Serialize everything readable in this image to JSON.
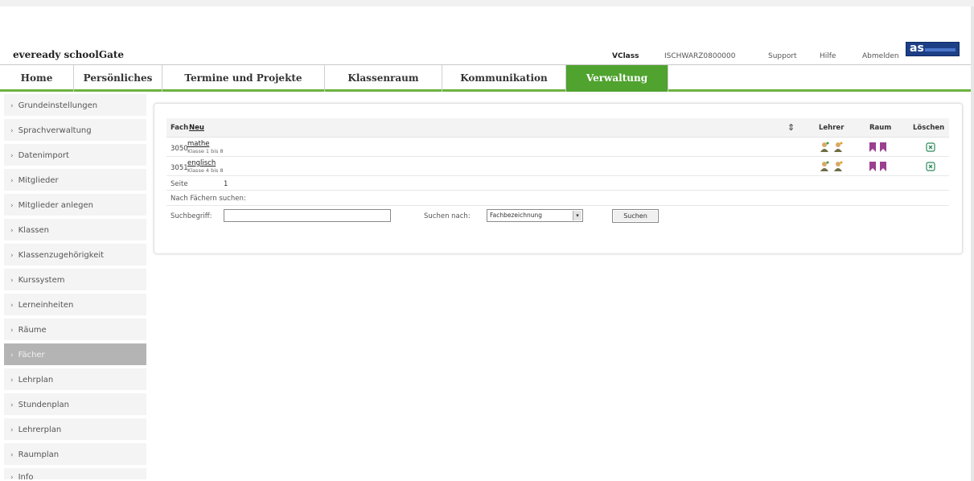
{
  "app": {
    "title": "eveready schoolGate",
    "logo_text": "as"
  },
  "header_meta": {
    "vclass": "VClass",
    "user_id": "ISCHWARZ0800000",
    "support": "Support",
    "help": "Hilfe",
    "logout": "Abmelden"
  },
  "tabs": [
    {
      "label": "Home"
    },
    {
      "label": "Persönliches"
    },
    {
      "label": "Termine und Projekte"
    },
    {
      "label": "Klassenraum"
    },
    {
      "label": "Kommunikation"
    },
    {
      "label": "Verwaltung",
      "active": true
    }
  ],
  "sidebar": {
    "items": [
      {
        "label": "Grundeinstellungen"
      },
      {
        "label": "Sprachverwaltung"
      },
      {
        "label": "Datenimport"
      },
      {
        "label": "Mitglieder"
      },
      {
        "label": "Mitglieder anlegen"
      },
      {
        "label": "Klassen"
      },
      {
        "label": "Klassenzugehörigkeit"
      },
      {
        "label": "Kurssystem"
      },
      {
        "label": "Lerneinheiten"
      },
      {
        "label": "Räume"
      },
      {
        "label": "Fächer",
        "active": true
      },
      {
        "label": "Lehrplan"
      },
      {
        "label": "Stundenplan"
      },
      {
        "label": "Lehrerplan"
      },
      {
        "label": "Raumplan"
      },
      {
        "label": "Info"
      }
    ]
  },
  "table": {
    "col_subject": "Fach",
    "new_link": "Neu",
    "sort_symbol": "⇕",
    "col_teacher": "Lehrer",
    "col_room": "Raum",
    "col_delete": "Löschen",
    "rows": [
      {
        "num": "3050",
        "name": "mathe",
        "sub": "Klasse 1 bis 8"
      },
      {
        "num": "3051",
        "name": "englisch",
        "sub": "Klasse 4 bis 8"
      }
    ]
  },
  "paging": {
    "label": "Seite",
    "page": "1"
  },
  "search": {
    "heading": "Nach Fächern suchen:",
    "term_label": "Suchbegriff:",
    "term_value": "",
    "by_label": "Suchen nach:",
    "by_value": "Fachbezeichnung",
    "button": "Suchen"
  },
  "colors": {
    "accent_green": "#4fa32e",
    "brand_blue": "#1d3f86",
    "room_icon": "#9b3f8f",
    "delete_icon": "#2f8a5d"
  }
}
